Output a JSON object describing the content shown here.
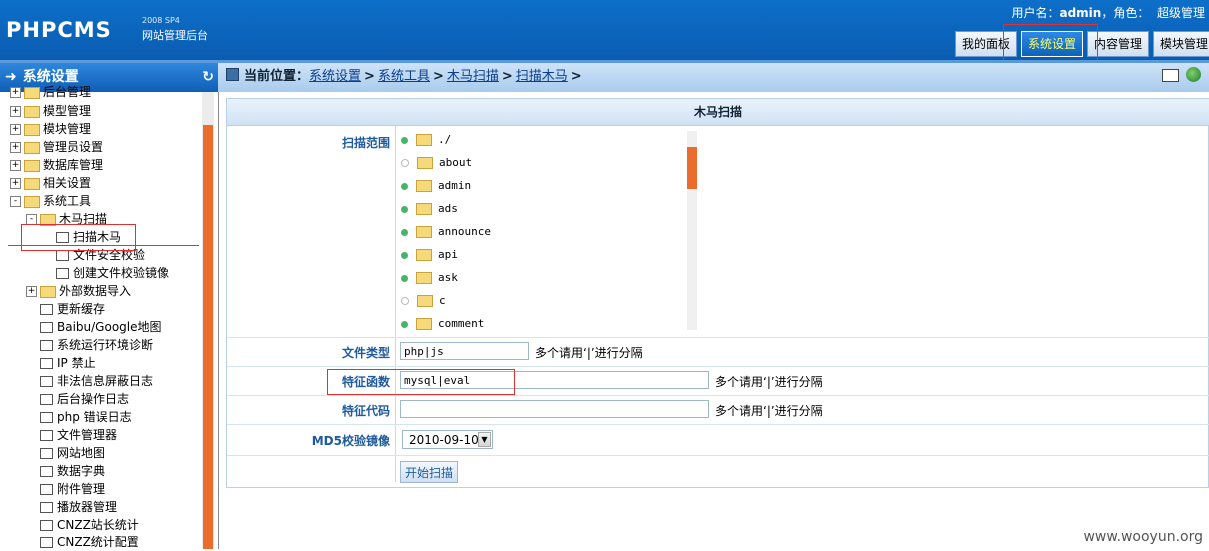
{
  "header": {
    "logo": "PHPCMS",
    "version": "2008 SP4",
    "subtitle": "网站管理后台",
    "user_label": "用户名：",
    "user_name": "admin",
    "role_label": "，角色：",
    "role_name": "超级管理",
    "tabs": [
      {
        "label": "我的面板",
        "active": false
      },
      {
        "label": "系统设置",
        "active": true
      },
      {
        "label": "内容管理",
        "active": false
      },
      {
        "label": "模块管理",
        "active": false
      }
    ]
  },
  "sidebar": {
    "title": "系统设置",
    "items": [
      {
        "label": "后台管理",
        "type": "folder",
        "expand": "+"
      },
      {
        "label": "模型管理",
        "type": "folder",
        "expand": "+"
      },
      {
        "label": "模块管理",
        "type": "folder",
        "expand": "+"
      },
      {
        "label": "管理员设置",
        "type": "folder",
        "expand": "+"
      },
      {
        "label": "数据库管理",
        "type": "folder",
        "expand": "+"
      },
      {
        "label": "相关设置",
        "type": "folder",
        "expand": "+"
      },
      {
        "label": "系统工具",
        "type": "folder",
        "expand": "-"
      },
      {
        "label": "木马扫描",
        "type": "folder",
        "expand": "-"
      },
      {
        "label": "扫描木马",
        "type": "doc",
        "selected": true
      },
      {
        "label": "文件安全校验",
        "type": "doc"
      },
      {
        "label": "创建文件校验镜像",
        "type": "doc"
      },
      {
        "label": "外部数据导入",
        "type": "folder",
        "expand": "+"
      },
      {
        "label": "更新缓存",
        "type": "doc"
      },
      {
        "label": "Baibu/Google地图",
        "type": "doc"
      },
      {
        "label": "系统运行环境诊断",
        "type": "doc"
      },
      {
        "label": "IP 禁止",
        "type": "doc"
      },
      {
        "label": "非法信息屏蔽日志",
        "type": "doc"
      },
      {
        "label": "后台操作日志",
        "type": "doc"
      },
      {
        "label": "php 错误日志",
        "type": "doc"
      },
      {
        "label": "文件管理器",
        "type": "doc"
      },
      {
        "label": "网站地图",
        "type": "doc"
      },
      {
        "label": "数据字典",
        "type": "doc"
      },
      {
        "label": "附件管理",
        "type": "doc"
      },
      {
        "label": "播放器管理",
        "type": "doc"
      },
      {
        "label": "CNZZ站长统计",
        "type": "doc"
      },
      {
        "label": "CNZZ统计配置",
        "type": "doc"
      }
    ]
  },
  "breadcrumb": {
    "prefix": "当前位置：",
    "items": [
      "系统设置",
      "系统工具",
      "木马扫描",
      "扫描木马"
    ],
    "sep": ">"
  },
  "form": {
    "title": "木马扫描",
    "scan_scope_label": "扫描范围",
    "dirs": [
      {
        "name": "./",
        "checked": true
      },
      {
        "name": "about",
        "checked": false
      },
      {
        "name": "admin",
        "checked": true
      },
      {
        "name": "ads",
        "checked": true
      },
      {
        "name": "announce",
        "checked": true
      },
      {
        "name": "api",
        "checked": true
      },
      {
        "name": "ask",
        "checked": true
      },
      {
        "name": "c",
        "checked": false
      },
      {
        "name": "comment",
        "checked": true
      }
    ],
    "file_type_label": "文件类型",
    "file_type_value": "php|js",
    "file_type_hint": "多个请用‘|’进行分隔",
    "func_label": "特征函数",
    "func_value": "mysql|eval",
    "func_hint": "多个请用‘|’进行分隔",
    "code_label": "特征代码",
    "code_value": "",
    "code_hint": "多个请用‘|’进行分隔",
    "md5_label": "MD5校验镜像",
    "md5_value": "2010-09-10",
    "submit_label": "开始扫描"
  },
  "watermark": "www.wooyun.org",
  "colors": {
    "accent": "#0b63bc",
    "scrollbar": "#ea6d2e",
    "highlight": "#e03030"
  }
}
